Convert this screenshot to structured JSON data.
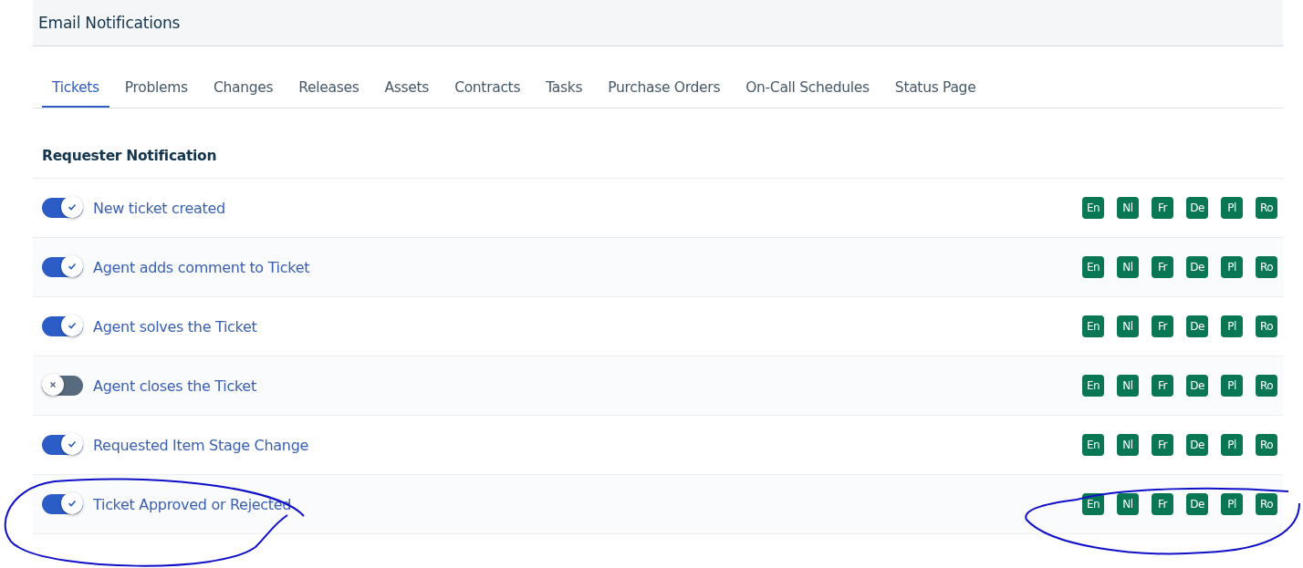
{
  "header": {
    "title": "Email Notifications"
  },
  "tabs": [
    {
      "label": "Tickets",
      "selected": true
    },
    {
      "label": "Problems",
      "selected": false
    },
    {
      "label": "Changes",
      "selected": false
    },
    {
      "label": "Releases",
      "selected": false
    },
    {
      "label": "Assets",
      "selected": false
    },
    {
      "label": "Contracts",
      "selected": false
    },
    {
      "label": "Tasks",
      "selected": false
    },
    {
      "label": "Purchase Orders",
      "selected": false
    },
    {
      "label": "On-Call Schedules",
      "selected": false
    },
    {
      "label": "Status Page",
      "selected": false
    }
  ],
  "section": {
    "title": "Requester Notification"
  },
  "notifications": [
    {
      "label": "New ticket created",
      "on": true,
      "languages": [
        "En",
        "Nl",
        "Fr",
        "De",
        "Pl",
        "Ro"
      ]
    },
    {
      "label": "Agent adds comment to Ticket",
      "on": true,
      "languages": [
        "En",
        "Nl",
        "Fr",
        "De",
        "Pl",
        "Ro"
      ]
    },
    {
      "label": "Agent solves the Ticket",
      "on": true,
      "languages": [
        "En",
        "Nl",
        "Fr",
        "De",
        "Pl",
        "Ro"
      ]
    },
    {
      "label": "Agent closes the Ticket",
      "on": false,
      "languages": [
        "En",
        "Nl",
        "Fr",
        "De",
        "Pl",
        "Ro"
      ]
    },
    {
      "label": "Requested Item Stage Change",
      "on": true,
      "languages": [
        "En",
        "Nl",
        "Fr",
        "De",
        "Pl",
        "Ro"
      ]
    },
    {
      "label": "Ticket Approved or Rejected",
      "on": true,
      "languages": [
        "En",
        "Nl",
        "Fr",
        "De",
        "Pl",
        "Ro"
      ]
    }
  ]
}
